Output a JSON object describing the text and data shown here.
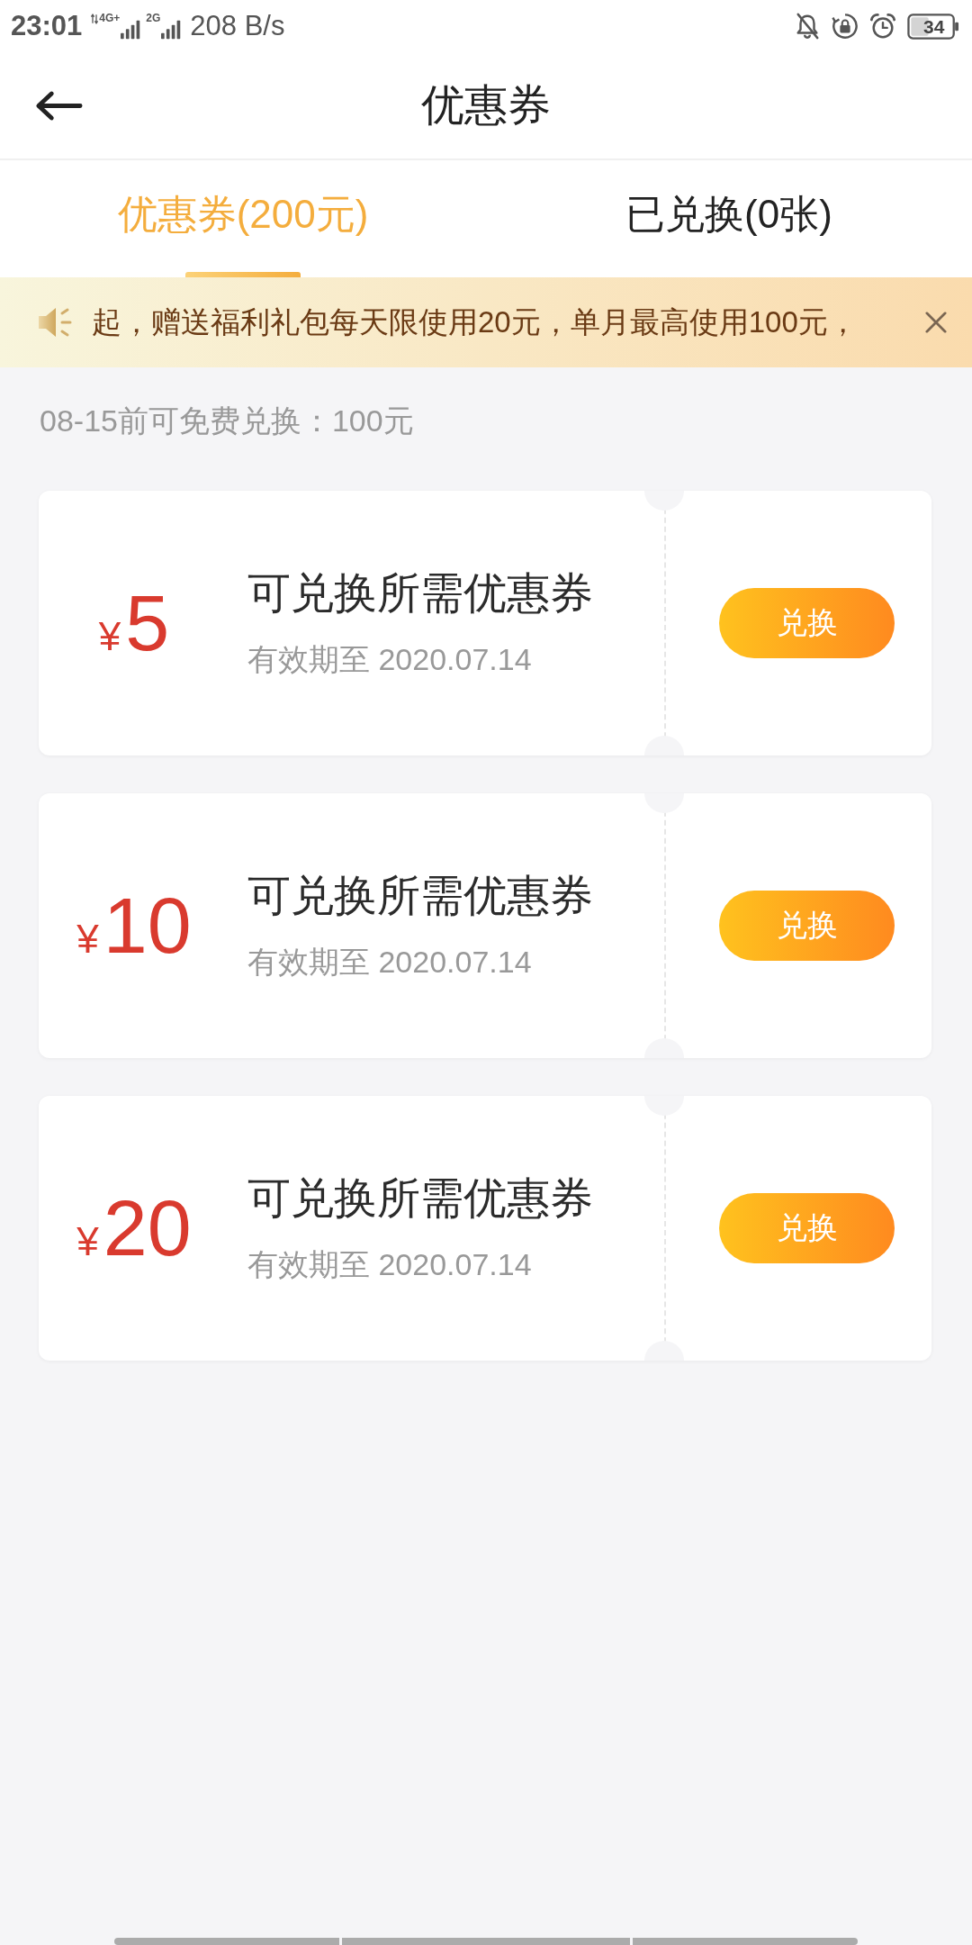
{
  "status_bar": {
    "time": "23:01",
    "networks": [
      {
        "label": "4G+",
        "activity": true
      },
      {
        "label": "2G",
        "activity": false
      }
    ],
    "speed": "208 B/s",
    "battery": "34"
  },
  "header": {
    "title": "优惠券"
  },
  "tabs": [
    {
      "label": "优惠券(200元)",
      "selected": true
    },
    {
      "label": "已兑换(0张)",
      "selected": false
    }
  ],
  "notice": {
    "text": "起，赠送福利礼包每天限使用20元，单月最高使用100元，"
  },
  "hint": "08-15前可免费兑换：100元",
  "coupons": [
    {
      "currency": "¥",
      "amount": "5",
      "title": "可兑换所需优惠券",
      "expiry": "有效期至 2020.07.14",
      "button": "兑换"
    },
    {
      "currency": "¥",
      "amount": "10",
      "title": "可兑换所需优惠券",
      "expiry": "有效期至 2020.07.14",
      "button": "兑换"
    },
    {
      "currency": "¥",
      "amount": "20",
      "title": "可兑换所需优惠券",
      "expiry": "有效期至 2020.07.14",
      "button": "兑换"
    }
  ]
}
